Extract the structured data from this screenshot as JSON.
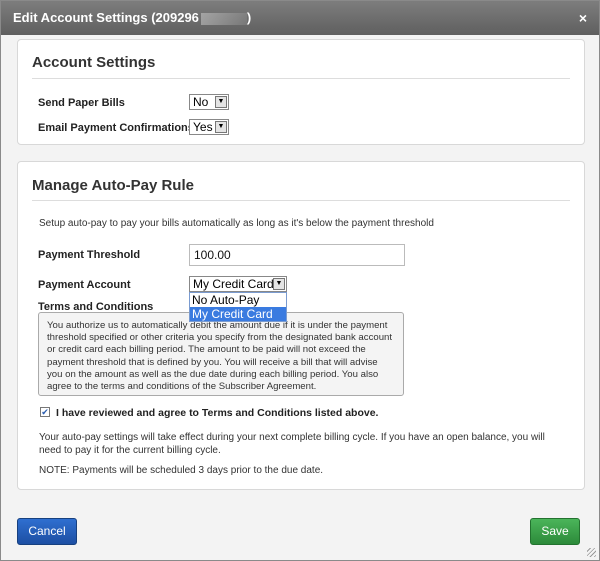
{
  "dialog": {
    "title": "Edit Account Settings (209296",
    "title_suffix": ")",
    "close_label": "×"
  },
  "account_settings": {
    "heading": "Account Settings",
    "send_paper_bills_label": "Send Paper Bills",
    "send_paper_bills_value": "No",
    "email_confirmations_label": "Email Payment Confirmations",
    "email_confirmations_value": "Yes"
  },
  "autopay": {
    "heading": "Manage Auto-Pay Rule",
    "intro": "Setup auto-pay to pay your bills automatically as long as it's below the payment threshold",
    "threshold_label": "Payment Threshold",
    "threshold_value": "100.00",
    "account_label": "Payment Account",
    "account_value": "My Credit Card",
    "account_options": [
      {
        "label": "No Auto-Pay",
        "selected": false
      },
      {
        "label": "My Credit Card",
        "selected": true
      }
    ],
    "terms_label": "Terms and Conditions",
    "terms_text": "You authorize us to automatically debit the amount due if it is under the payment threshold specified or other criteria you specify from the designated bank account or credit card each billing period. The amount to be paid will not exceed the payment threshold that is defined by you. You will receive a bill that will advise you on the amount as well as the due date during each billing period. You also agree to the terms and conditions of the Subscriber Agreement.",
    "agree_checked": true,
    "agree_label": "I have reviewed and agree to Terms and Conditions listed above.",
    "effect_note": "Your auto-pay settings will take effect during your next complete billing cycle. If you have an open balance, you will need to pay it for the current billing cycle.",
    "schedule_note": "NOTE: Payments will be scheduled 3 days prior to the due date."
  },
  "footer": {
    "cancel_label": "Cancel",
    "save_label": "Save"
  },
  "colors": {
    "cancel": "#1d4fa3",
    "save": "#2c8a3a",
    "selected_option": "#3a7be0"
  }
}
